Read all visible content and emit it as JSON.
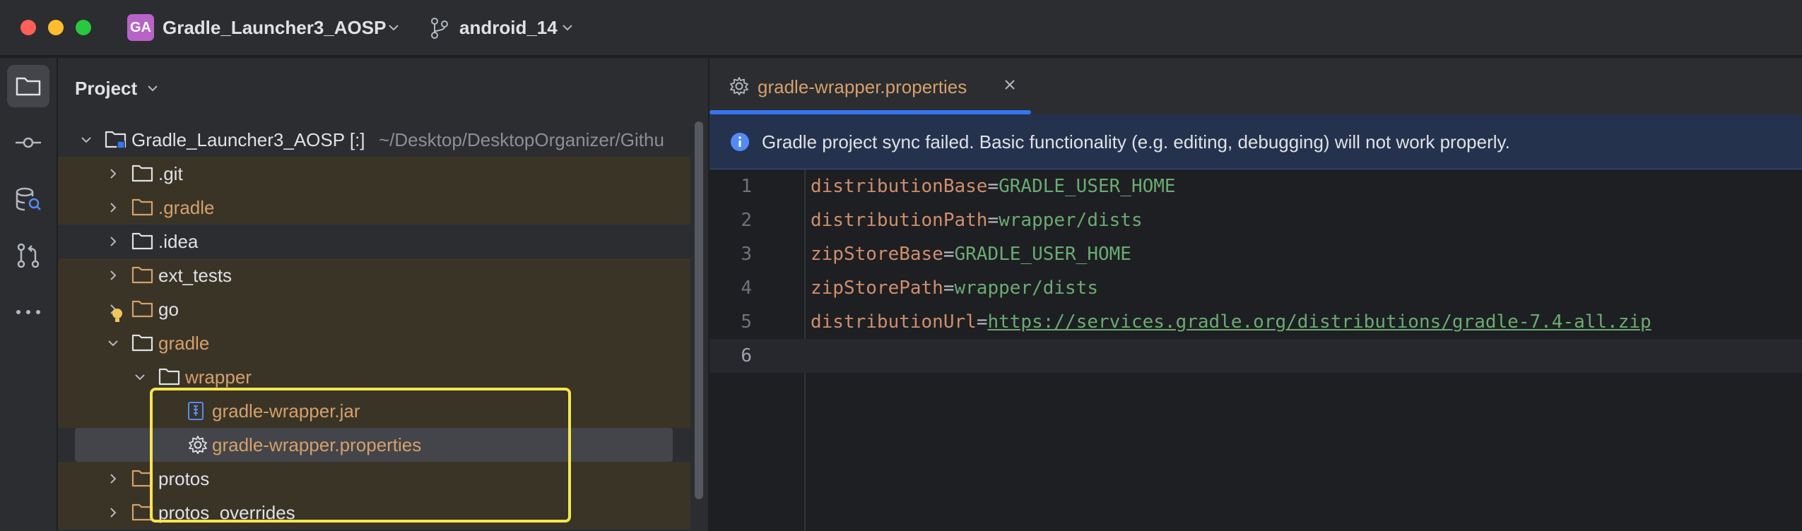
{
  "window": {
    "project_badge": "GA",
    "project_name": "Gradle_Launcher3_AOSP",
    "branch": "android_14"
  },
  "project_panel": {
    "title": "Project",
    "root": {
      "name": "Gradle_Launcher3_AOSP [:]",
      "path": "~/Desktop/DesktopOrganizer/Githu"
    },
    "items": [
      {
        "label": ".git"
      },
      {
        "label": ".gradle"
      },
      {
        "label": ".idea"
      },
      {
        "label": "ext_tests"
      },
      {
        "label": "go"
      },
      {
        "label": "gradle"
      },
      {
        "label": "wrapper"
      },
      {
        "label": "gradle-wrapper.jar"
      },
      {
        "label": "gradle-wrapper.properties"
      },
      {
        "label": "protos"
      },
      {
        "label": "protos_overrides"
      }
    ]
  },
  "editor": {
    "tab_label": "gradle-wrapper.properties",
    "banner": "Gradle project sync failed. Basic functionality (e.g. editing, debugging) will not work properly.",
    "lines": [
      {
        "num": "1",
        "key": "distributionBase",
        "eq": "=",
        "value": "GRADLE_USER_HOME"
      },
      {
        "num": "2",
        "key": "distributionPath",
        "eq": "=",
        "value": "wrapper/dists"
      },
      {
        "num": "3",
        "key": "zipStoreBase",
        "eq": "=",
        "value": "GRADLE_USER_HOME"
      },
      {
        "num": "4",
        "key": "zipStorePath",
        "eq": "=",
        "value": "wrapper/dists"
      },
      {
        "num": "5",
        "key": "distributionUrl",
        "eq": "=",
        "value": "https://services.gradle.org/distributions/gradle-7.4-all.zip"
      },
      {
        "num": "6",
        "key": "",
        "eq": "",
        "value": ""
      }
    ]
  },
  "colors": {
    "accent": "#3574f0",
    "ignored_text": "#d5a06b",
    "highlight_box": "#f6e54d",
    "key": "#cf8e6d",
    "value": "#6aab73"
  }
}
